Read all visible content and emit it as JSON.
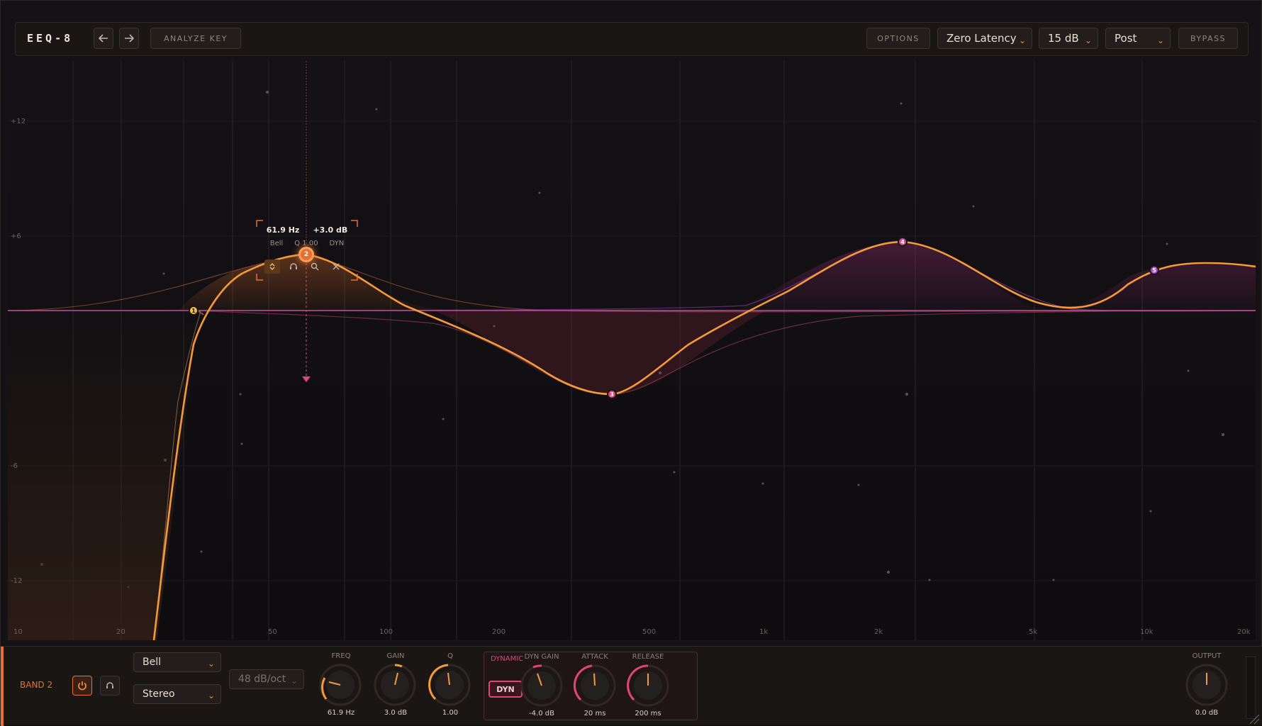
{
  "header": {
    "logo": "EEQ-8",
    "undo_icon": "arrow-left-icon",
    "redo_icon": "arrow-right-icon",
    "analyze_label": "ANALYZE KEY",
    "options_label": "OPTIONS",
    "latency_value": "Zero Latency",
    "range_value": "15 dB",
    "analyzer_value": "Post",
    "bypass_label": "BYPASS"
  },
  "graph": {
    "db_labels": [
      "+12",
      "+6",
      "-6",
      "-12"
    ],
    "freq_labels": [
      "10",
      "20",
      "50",
      "100",
      "200",
      "500",
      "1k",
      "2k",
      "5k",
      "10k",
      "20k"
    ],
    "nodes": [
      "1",
      "2",
      "3",
      "4",
      "5"
    ],
    "colors": {
      "orange": "#f59a3a",
      "pink": "#e0457a",
      "purple": "#b04ad0",
      "yellow": "#f2c14e"
    }
  },
  "popup": {
    "freq": "61.9 Hz",
    "gain": "+3.0 dB",
    "type": "Bell",
    "q": "Q 1.00",
    "dyn": "DYN"
  },
  "band": {
    "label": "BAND 2",
    "type_value": "Bell",
    "channel_value": "Stereo",
    "slope_value": "48 dB/oct",
    "knobs": [
      {
        "label": "FREQ",
        "value": "61.9 Hz"
      },
      {
        "label": "GAIN",
        "value": "3.0 dB"
      },
      {
        "label": "Q",
        "value": "1.00"
      }
    ],
    "dynamic_label": "DYNAMIC",
    "dyn_button": "DYN",
    "dyn_knobs": [
      {
        "label": "DYN GAIN",
        "value": "-4.0 dB"
      },
      {
        "label": "ATTACK",
        "value": "20 ms"
      },
      {
        "label": "RELEASE",
        "value": "200 ms"
      }
    ],
    "output_label": "OUTPUT",
    "output_value": "0.0 dB"
  }
}
